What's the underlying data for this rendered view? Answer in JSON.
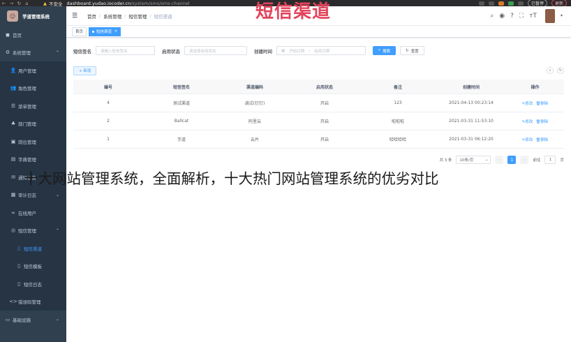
{
  "browser": {
    "insecure_label": "不安全",
    "url_host": "dashboard.yudao.iocoder.cn",
    "url_path": "/system/sms/sms-channel",
    "profile_label": "已暂停",
    "update_label": "更新"
  },
  "overlay": {
    "title": "短信渠道",
    "caption": "十大网站管理系统，全面解析，十大热门网站管理系统的优劣对比"
  },
  "sidebar": {
    "app_title": "芋道管理系统",
    "items": [
      {
        "label": "首页",
        "icon": "dashboard-icon"
      },
      {
        "label": "系统管理",
        "icon": "gear-icon"
      },
      {
        "label": "用户管理",
        "icon": "user-icon"
      },
      {
        "label": "角色管理",
        "icon": "peoples-icon"
      },
      {
        "label": "菜单管理",
        "icon": "tree-table-icon"
      },
      {
        "label": "部门管理",
        "icon": "tree-icon"
      },
      {
        "label": "岗位管理",
        "icon": "post-icon"
      },
      {
        "label": "字典管理",
        "icon": "dict-icon"
      },
      {
        "label": "通知公告",
        "icon": "message-icon"
      },
      {
        "label": "审计日志",
        "icon": "log-icon"
      },
      {
        "label": "在线用户",
        "icon": "online-icon"
      },
      {
        "label": "短信管理",
        "icon": "sms-icon"
      },
      {
        "label": "短信渠道",
        "icon": "channel-icon"
      },
      {
        "label": "短信模板",
        "icon": "template-icon"
      },
      {
        "label": "短信日志",
        "icon": "sms-log-icon"
      },
      {
        "label": "错误码管理",
        "icon": "code-icon"
      },
      {
        "label": "基础设施",
        "icon": "monitor-icon"
      }
    ]
  },
  "breadcrumb": {
    "items": [
      "首页",
      "系统管理",
      "短信管理",
      "短信渠道"
    ]
  },
  "tags": {
    "home": "首页",
    "current": "短信渠道"
  },
  "search": {
    "signature_label": "短信签名",
    "signature_placeholder": "请输入短信签名",
    "status_label": "启用状态",
    "status_placeholder": "请选择启用状态",
    "time_label": "创建时间",
    "start_placeholder": "开始日期",
    "range_sep": "-",
    "end_placeholder": "结束日期",
    "search_button": "搜索",
    "reset_button": "重置"
  },
  "toolbar": {
    "add_button": "+ 新增"
  },
  "table": {
    "columns": [
      "编号",
      "短信签名",
      "渠道编码",
      "启用状态",
      "备注",
      "创建时间",
      "操作"
    ],
    "rows": [
      {
        "id": "4",
        "signature": "测试渠道",
        "code": "调试(钉钉)",
        "status": "开启",
        "remark": "123",
        "created": "2021-04-13 00:23:14"
      },
      {
        "id": "2",
        "signature": "Ballcat",
        "code": "阿里云",
        "status": "开启",
        "remark": "啦啦啦",
        "created": "2021-03-31 11:53:10"
      },
      {
        "id": "1",
        "signature": "芋道",
        "code": "云片",
        "status": "开启",
        "remark": "哈哈哈哈",
        "created": "2021-03-31 06:12:20"
      }
    ],
    "edit_label": "修改",
    "delete_label": "删除"
  },
  "pagination": {
    "total_text": "共 3 条",
    "page_size": "10条/页",
    "current_page": "1",
    "goto_label": "前往",
    "goto_value": "1",
    "page_unit": "页"
  },
  "colors": {
    "sidebar_bg": "#30404f",
    "primary": "#409eff",
    "title_red": "#e2445c"
  }
}
